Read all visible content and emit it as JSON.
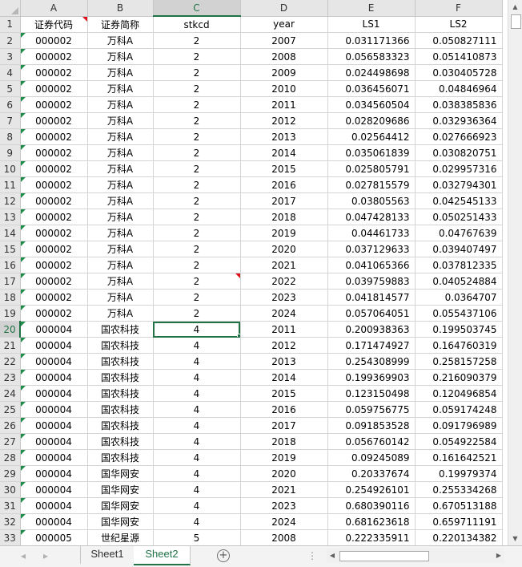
{
  "columns": [
    {
      "letter": "A",
      "selected": false
    },
    {
      "letter": "B",
      "selected": false
    },
    {
      "letter": "C",
      "selected": true
    },
    {
      "letter": "D",
      "selected": false
    },
    {
      "letter": "E",
      "selected": false
    },
    {
      "letter": "F",
      "selected": false
    }
  ],
  "header_row": {
    "num": "1",
    "cells": [
      "证券代码",
      "证券简称",
      "stkcd",
      "year",
      "LS1",
      "LS2"
    ]
  },
  "rows": [
    {
      "num": "2",
      "cells": [
        "000002",
        "万科A",
        "2",
        "2007",
        "0.031171366",
        "0.050827111"
      ]
    },
    {
      "num": "3",
      "cells": [
        "000002",
        "万科A",
        "2",
        "2008",
        "0.056583323",
        "0.051410873"
      ]
    },
    {
      "num": "4",
      "cells": [
        "000002",
        "万科A",
        "2",
        "2009",
        "0.024498698",
        "0.030405728"
      ]
    },
    {
      "num": "5",
      "cells": [
        "000002",
        "万科A",
        "2",
        "2010",
        "0.036456071",
        "0.04846964"
      ]
    },
    {
      "num": "6",
      "cells": [
        "000002",
        "万科A",
        "2",
        "2011",
        "0.034560504",
        "0.038385836"
      ]
    },
    {
      "num": "7",
      "cells": [
        "000002",
        "万科A",
        "2",
        "2012",
        "0.028209686",
        "0.032936364"
      ]
    },
    {
      "num": "8",
      "cells": [
        "000002",
        "万科A",
        "2",
        "2013",
        "0.02564412",
        "0.027666923"
      ]
    },
    {
      "num": "9",
      "cells": [
        "000002",
        "万科A",
        "2",
        "2014",
        "0.035061839",
        "0.030820751"
      ]
    },
    {
      "num": "10",
      "cells": [
        "000002",
        "万科A",
        "2",
        "2015",
        "0.025805791",
        "0.029957316"
      ]
    },
    {
      "num": "11",
      "cells": [
        "000002",
        "万科A",
        "2",
        "2016",
        "0.027815579",
        "0.032794301"
      ]
    },
    {
      "num": "12",
      "cells": [
        "000002",
        "万科A",
        "2",
        "2017",
        "0.03805563",
        "0.042545133"
      ]
    },
    {
      "num": "13",
      "cells": [
        "000002",
        "万科A",
        "2",
        "2018",
        "0.047428133",
        "0.050251433"
      ]
    },
    {
      "num": "14",
      "cells": [
        "000002",
        "万科A",
        "2",
        "2019",
        "0.04461733",
        "0.04767639"
      ]
    },
    {
      "num": "15",
      "cells": [
        "000002",
        "万科A",
        "2",
        "2020",
        "0.037129633",
        "0.039407497"
      ]
    },
    {
      "num": "16",
      "cells": [
        "000002",
        "万科A",
        "2",
        "2021",
        "0.041065366",
        "0.037812335"
      ]
    },
    {
      "num": "17",
      "cells": [
        "000002",
        "万科A",
        "2",
        "2022",
        "0.039759883",
        "0.040524884"
      ]
    },
    {
      "num": "18",
      "cells": [
        "000002",
        "万科A",
        "2",
        "2023",
        "0.041814577",
        "0.0364707"
      ]
    },
    {
      "num": "19",
      "cells": [
        "000002",
        "万科A",
        "2",
        "2024",
        "0.057064051",
        "0.055437106"
      ]
    },
    {
      "num": "20",
      "cells": [
        "000004",
        "国农科技",
        "4",
        "2011",
        "0.200938363",
        "0.199503745"
      ]
    },
    {
      "num": "21",
      "cells": [
        "000004",
        "国农科技",
        "4",
        "2012",
        "0.171474927",
        "0.164760319"
      ]
    },
    {
      "num": "22",
      "cells": [
        "000004",
        "国农科技",
        "4",
        "2013",
        "0.254308999",
        "0.258157258"
      ]
    },
    {
      "num": "23",
      "cells": [
        "000004",
        "国农科技",
        "4",
        "2014",
        "0.199369903",
        "0.216090379"
      ]
    },
    {
      "num": "24",
      "cells": [
        "000004",
        "国农科技",
        "4",
        "2015",
        "0.123150498",
        "0.120496854"
      ]
    },
    {
      "num": "25",
      "cells": [
        "000004",
        "国农科技",
        "4",
        "2016",
        "0.059756775",
        "0.059174248"
      ]
    },
    {
      "num": "26",
      "cells": [
        "000004",
        "国农科技",
        "4",
        "2017",
        "0.091853528",
        "0.091796989"
      ]
    },
    {
      "num": "27",
      "cells": [
        "000004",
        "国农科技",
        "4",
        "2018",
        "0.056760142",
        "0.054922584"
      ]
    },
    {
      "num": "28",
      "cells": [
        "000004",
        "国农科技",
        "4",
        "2019",
        "0.09245089",
        "0.161642521"
      ]
    },
    {
      "num": "29",
      "cells": [
        "000004",
        "国华网安",
        "4",
        "2020",
        "0.20337674",
        "0.19979374"
      ]
    },
    {
      "num": "30",
      "cells": [
        "000004",
        "国华网安",
        "4",
        "2021",
        "0.254926101",
        "0.255334268"
      ]
    },
    {
      "num": "31",
      "cells": [
        "000004",
        "国华网安",
        "4",
        "2023",
        "0.680390116",
        "0.670513188"
      ]
    },
    {
      "num": "32",
      "cells": [
        "000004",
        "国华网安",
        "4",
        "2024",
        "0.681623618",
        "0.659711191"
      ]
    },
    {
      "num": "33",
      "cells": [
        "000005",
        "世纪星源",
        "5",
        "2008",
        "0.222335911",
        "0.220134382"
      ]
    }
  ],
  "active_cell": {
    "row": "20",
    "col": "C"
  },
  "sheet_tabs": [
    {
      "label": "Sheet1",
      "active": false
    },
    {
      "label": "Sheet2",
      "active": true
    }
  ],
  "icons": {
    "add_sheet": "plus-circle-icon",
    "scroll_left": "triangle-left-icon",
    "scroll_right": "triangle-right-icon",
    "scroll_up": "triangle-up-icon",
    "scroll_down": "triangle-down-icon"
  },
  "colors": {
    "accent": "#217346",
    "comment_marker": "#e0101d",
    "error_marker": "#1f8c4a"
  }
}
